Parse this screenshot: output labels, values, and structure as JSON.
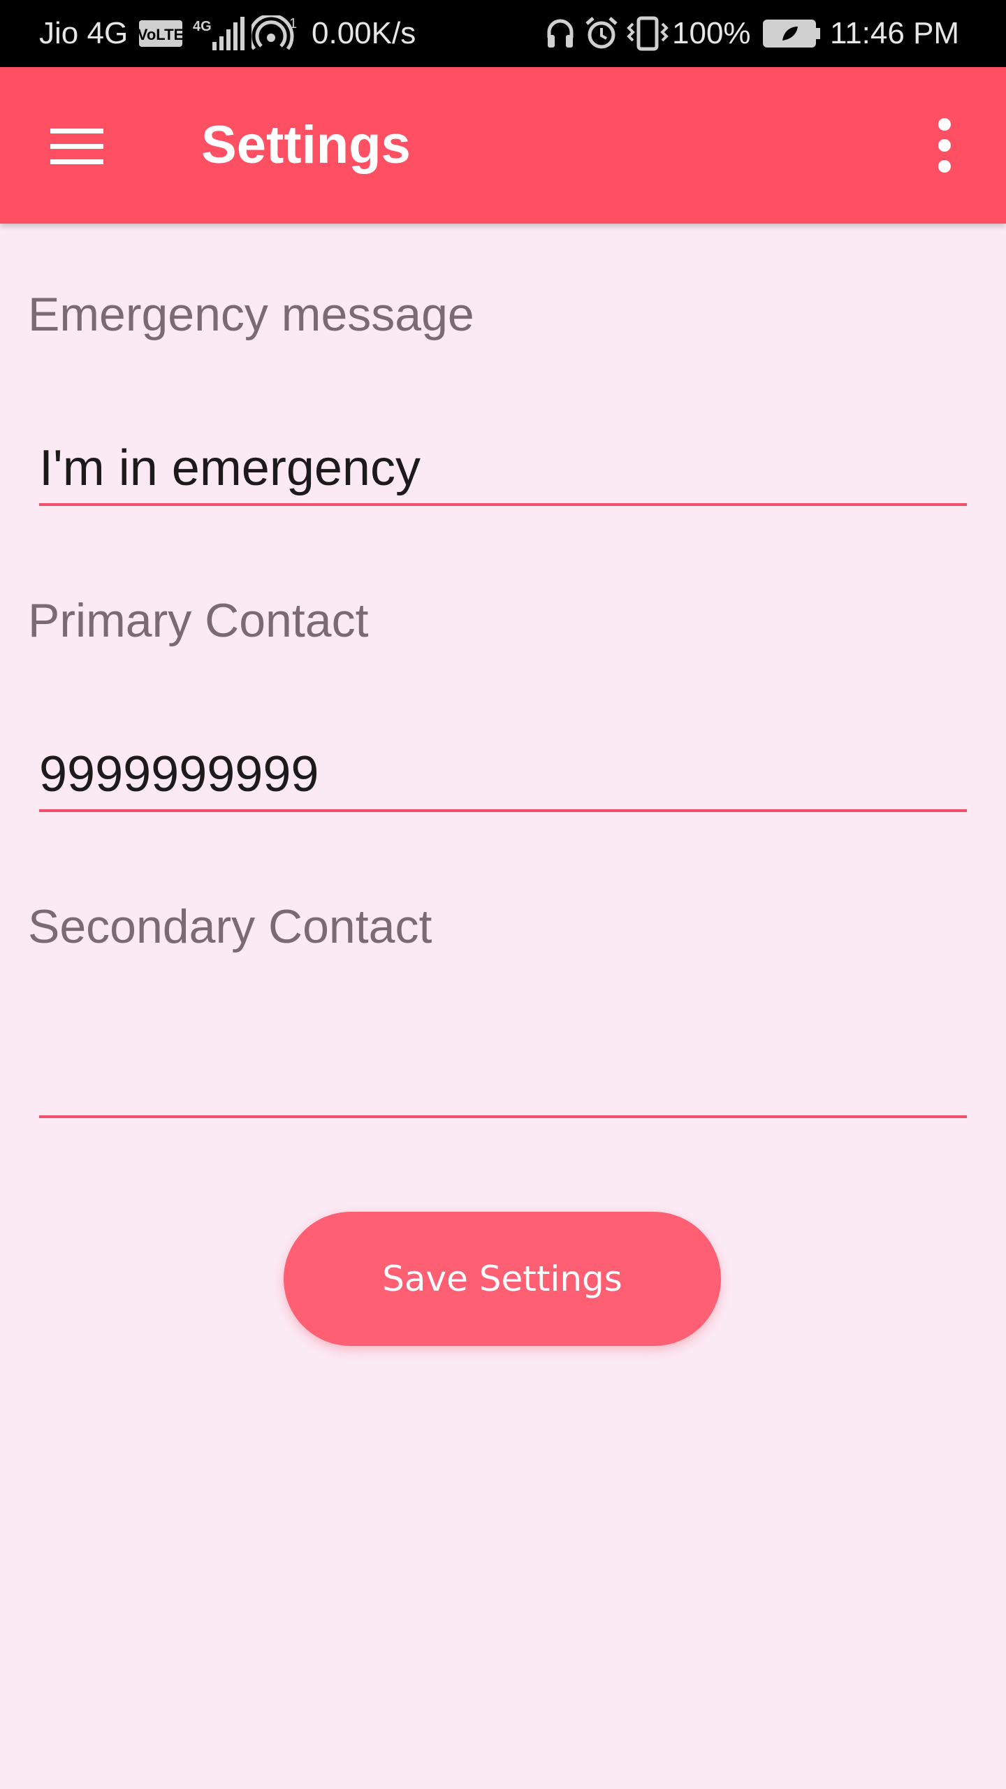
{
  "status_bar": {
    "carrier": "Jio 4G",
    "volte": "VoLTE",
    "network": "4G",
    "hotspot_count": "1",
    "speed": "0.00K/s",
    "battery": "100%",
    "time": "11:46 PM"
  },
  "app_bar": {
    "title": "Settings",
    "menu_icon": "hamburger-menu-icon",
    "overflow_icon": "more-vert-icon",
    "color": "#ff4f62"
  },
  "form": {
    "emergency_message": {
      "label": "Emergency message",
      "value": "I'm in emergency"
    },
    "primary_contact": {
      "label": "Primary Contact",
      "value": "9999999999"
    },
    "secondary_contact": {
      "label": "Secondary Contact",
      "value": ""
    },
    "underline_color": "#f0506a"
  },
  "save_button": {
    "label": "Save Settings",
    "color": "#ff5f72"
  }
}
